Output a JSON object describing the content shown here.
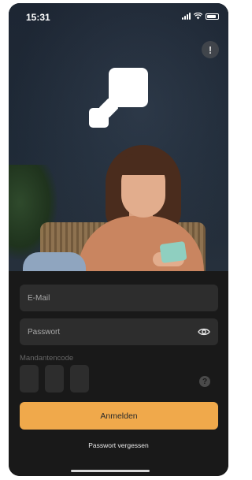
{
  "status_bar": {
    "time": "15:31"
  },
  "header": {
    "info_button_label": "!"
  },
  "form": {
    "email_placeholder": "E-Mail",
    "password_placeholder": "Passwort",
    "client_code_label": "Mandantencode",
    "help_label": "?",
    "login_button_label": "Anmelden",
    "forgot_password_label": "Passwort vergessen"
  },
  "colors": {
    "accent": "#f0a94b",
    "background": "#191919",
    "field": "#2d2d2d"
  },
  "icons": [
    "signal-icon",
    "wifi-icon",
    "battery-icon",
    "info-icon",
    "app-logo-icon",
    "eye-icon",
    "help-icon"
  ]
}
